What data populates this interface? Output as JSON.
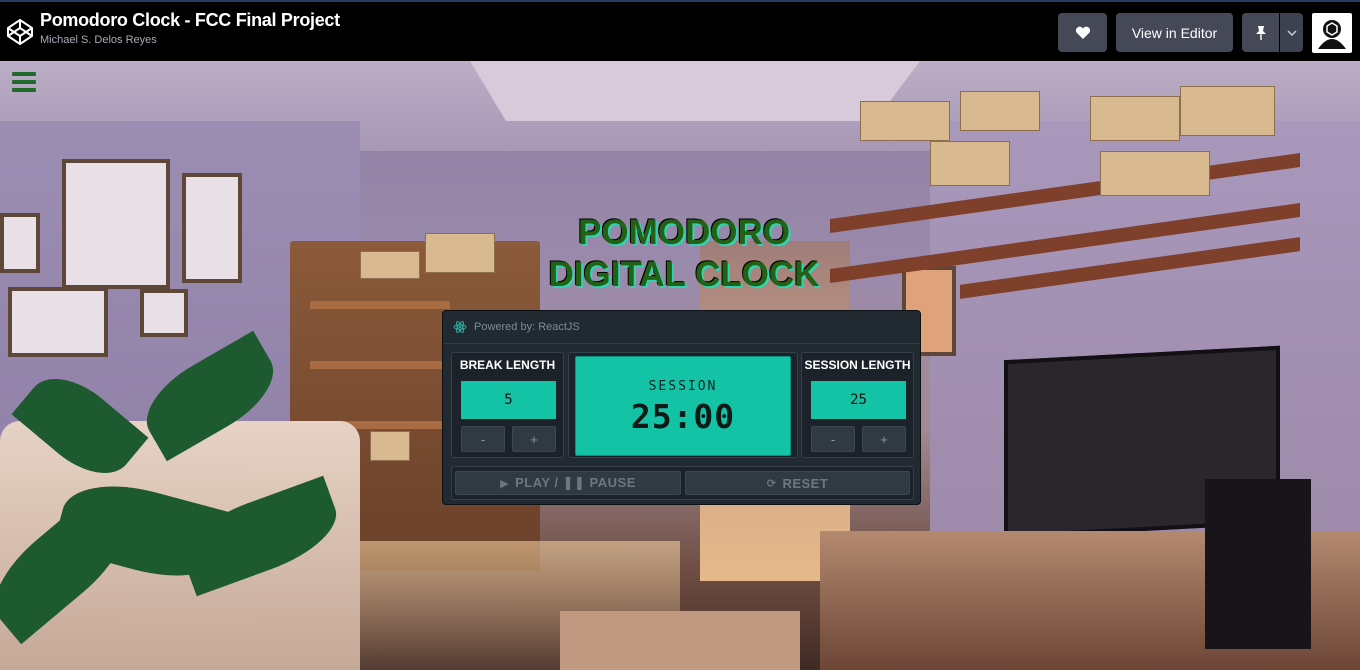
{
  "header": {
    "title": "Pomodoro Clock - FCC Final Project",
    "author": "Michael S. Delos Reyes",
    "view_in_editor_label": "View in Editor",
    "icons": {
      "logo": "codepen-logo-icon",
      "heart": "heart-icon",
      "pin": "pin-icon",
      "caret": "chevron-down-icon",
      "avatar": "user-avatar-icon"
    }
  },
  "page": {
    "menu_icon": "hamburger-menu-icon",
    "headline_line1": "POMODORO",
    "headline_line2": "DIGITAL CLOCK"
  },
  "clock": {
    "powered_by": "Powered by: ReactJS",
    "break": {
      "label": "BREAK LENGTH",
      "value": "5",
      "decrement": "-",
      "increment": "+"
    },
    "session": {
      "label": "SESSION LENGTH",
      "value": "25",
      "decrement": "-",
      "increment": "+"
    },
    "display": {
      "label": "SESSION",
      "time": "25:00"
    },
    "controls": {
      "play_pause": "PLAY / ❚❚ PAUSE",
      "reset": "RESET"
    }
  },
  "colors": {
    "accent": "#14c2a5",
    "headline": "#226116",
    "panel": "#222a31",
    "header_button": "#444857"
  }
}
